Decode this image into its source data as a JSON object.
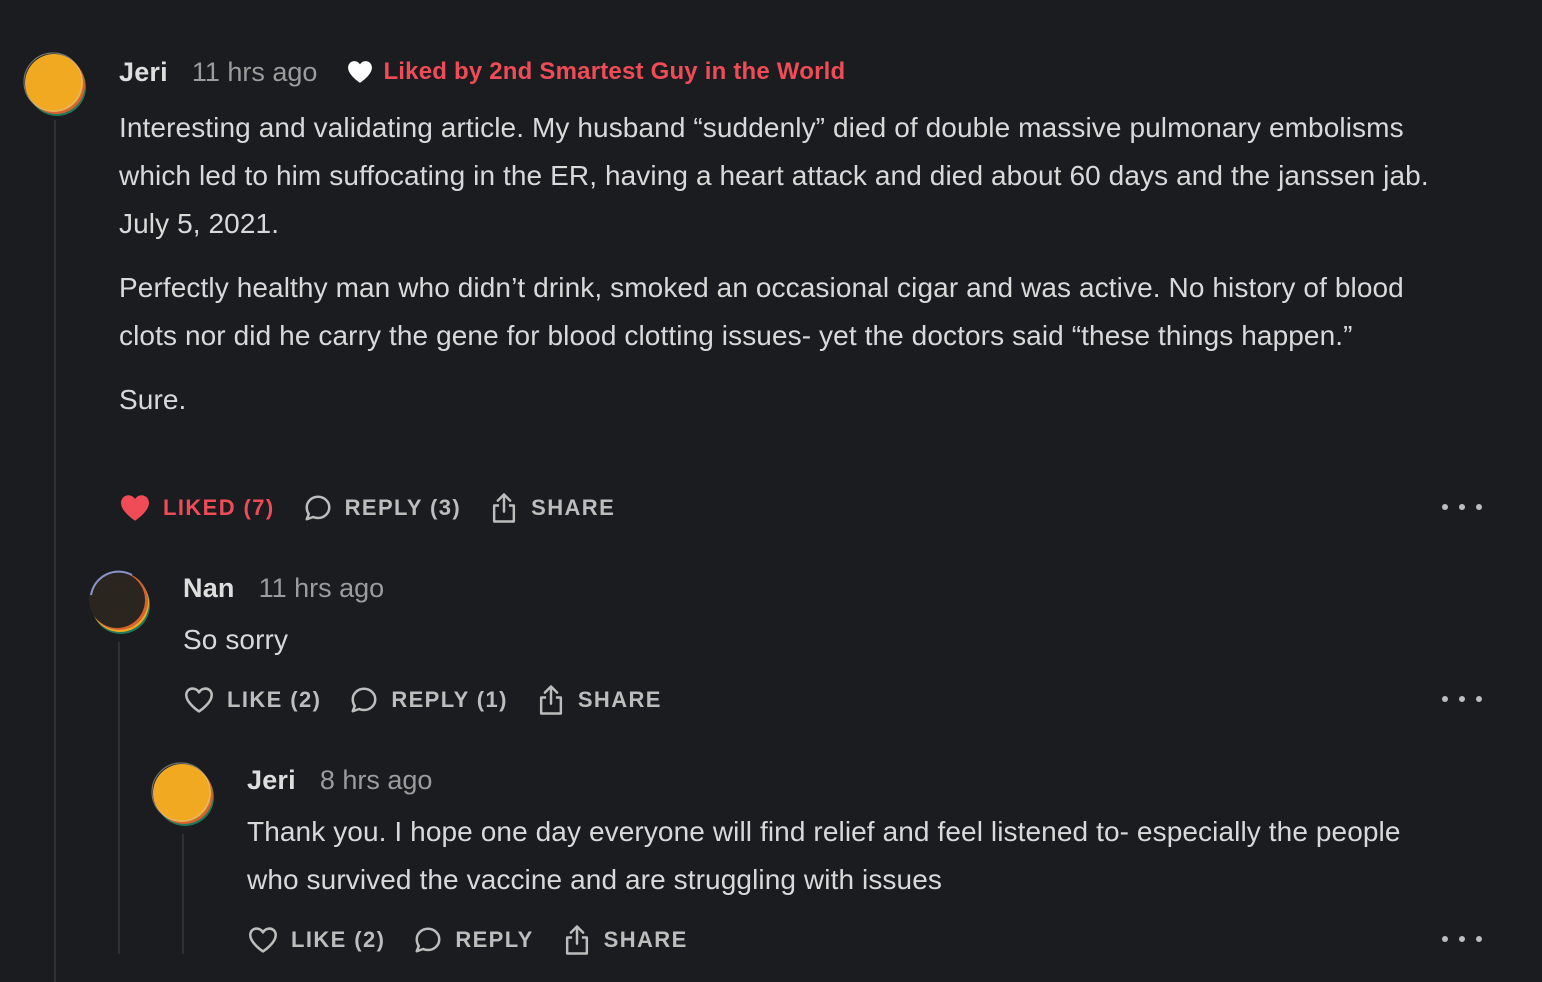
{
  "comments": [
    {
      "author": "Jeri",
      "time": "11 hrs ago",
      "liked_by": "Liked by 2nd Smartest Guy in the World",
      "paragraphs": [
        "Interesting and validating article. My husband “suddenly” died of double massive pulmonary embolisms which led to him suffocating in the ER, having a heart attack and died about 60 days and the janssen jab. July 5, 2021.",
        "Perfectly healthy man who didn’t drink, smoked an occasional cigar and was active. No history of blood clots nor did he carry the gene for blood clotting issues- yet the doctors said “these things happen.”",
        "Sure."
      ],
      "like_label": "LIKED (7)",
      "reply_label": "REPLY (3)",
      "share_label": "SHARE"
    },
    {
      "author": "Nan",
      "time": "11 hrs ago",
      "paragraphs": [
        "So sorry"
      ],
      "like_label": "LIKE (2)",
      "reply_label": "REPLY (1)",
      "share_label": "SHARE"
    },
    {
      "author": "Jeri",
      "time": "8 hrs ago",
      "paragraphs": [
        "Thank you. I hope one day everyone will find relief and feel listened to- especially the people who survived the vaccine and are struggling with issues"
      ],
      "like_label": "LIKE (2)",
      "reply_label": "REPLY",
      "share_label": "SHARE"
    }
  ],
  "colors": {
    "background": "#1b1c1f",
    "accent_red": "#ef4c57",
    "muted_text": "#9c9c9c"
  },
  "icons": {
    "liked_by": "heart-icon",
    "like_filled": "heart-filled-icon",
    "like_outline": "heart-outline-icon",
    "reply": "speech-bubble-icon",
    "share": "share-icon",
    "more": "ellipsis-icon"
  }
}
